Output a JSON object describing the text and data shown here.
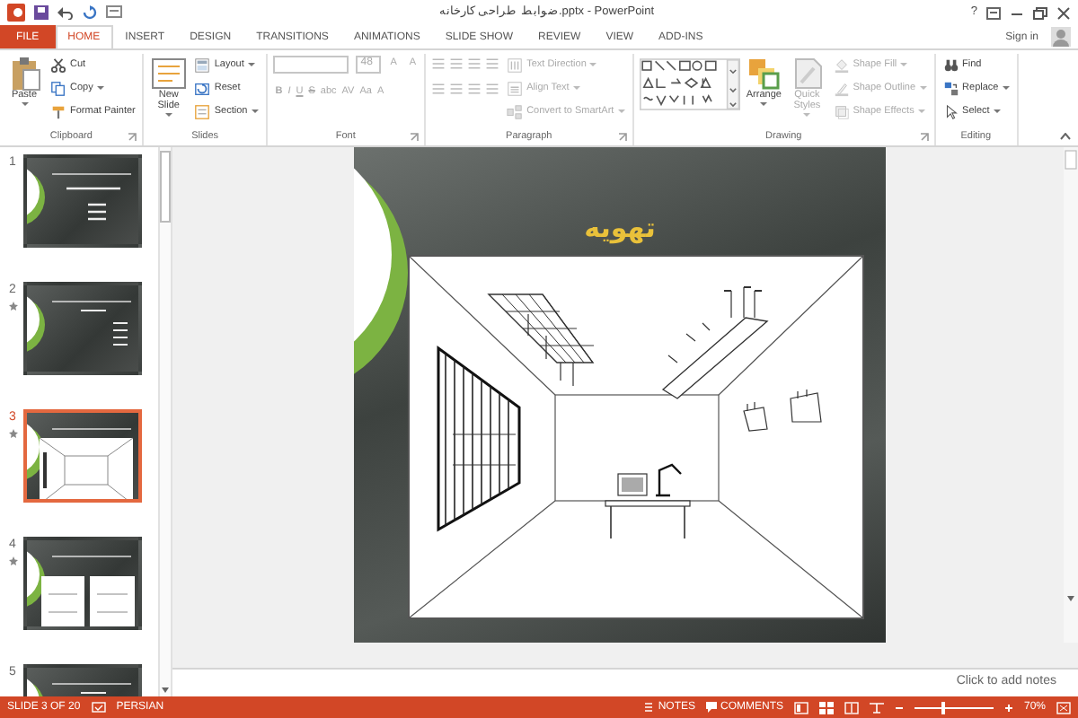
{
  "window": {
    "title": "ضوابط طراحی کارخانه.pptx - PowerPoint",
    "help": "?"
  },
  "tabs": [
    {
      "label": "FILE",
      "kind": "file",
      "selected": false
    },
    {
      "label": "HOME",
      "kind": "tab",
      "selected": true
    },
    {
      "label": "INSERT",
      "kind": "tab",
      "selected": false
    },
    {
      "label": "DESIGN",
      "kind": "tab",
      "selected": false
    },
    {
      "label": "TRANSITIONS",
      "kind": "tab",
      "selected": false
    },
    {
      "label": "ANIMATIONS",
      "kind": "tab",
      "selected": false
    },
    {
      "label": "SLIDE SHOW",
      "kind": "tab",
      "selected": false
    },
    {
      "label": "REVIEW",
      "kind": "tab",
      "selected": false
    },
    {
      "label": "VIEW",
      "kind": "tab",
      "selected": false
    },
    {
      "label": "ADD-INS",
      "kind": "tab",
      "selected": false
    }
  ],
  "account": {
    "label": "Sign in"
  },
  "ribbon": [
    {
      "label": "Clipboard",
      "kind": "standard",
      "launcher": true,
      "columns": [
        [
          {
            "label": "Paste",
            "kind": "large",
            "dropdown": true,
            "disabled": false
          }
        ],
        [
          {
            "label": "Cut",
            "kind": "small",
            "dropdown": false,
            "disabled": false
          },
          {
            "label": "Copy",
            "kind": "small",
            "dropdown": true,
            "disabled": false
          },
          {
            "label": "Format Painter",
            "kind": "small",
            "dropdown": false,
            "disabled": false
          }
        ]
      ]
    },
    {
      "label": "Slides",
      "kind": "standard",
      "launcher": false,
      "columns": [
        [
          {
            "label": "New Slide",
            "kind": "large",
            "dropdown": true,
            "disabled": false
          }
        ],
        [
          {
            "label": "Layout",
            "kind": "small",
            "dropdown": true,
            "disabled": false
          },
          {
            "label": "Reset",
            "kind": "small",
            "dropdown": false,
            "disabled": false
          },
          {
            "label": "Section",
            "kind": "small",
            "dropdown": true,
            "disabled": false
          }
        ]
      ]
    },
    {
      "label": "Font",
      "kind": "font",
      "launcher": true,
      "disabled": true,
      "font_size": "48",
      "row_1": [
        "A",
        "A"
      ],
      "row_2": [
        "B",
        "I",
        "U",
        "S",
        "abc",
        "AV",
        "Aa",
        "A"
      ]
    },
    {
      "label": "Paragraph",
      "kind": "paragraph",
      "launcher": true,
      "columns": [
        [
          {
            "label": "Text Direction",
            "kind": "small",
            "dropdown": true,
            "disabled": true
          },
          {
            "label": "Align Text",
            "kind": "small",
            "dropdown": true,
            "disabled": true
          },
          {
            "label": "Convert to SmartArt",
            "kind": "small",
            "dropdown": true,
            "disabled": true
          }
        ]
      ]
    },
    {
      "label": "Drawing",
      "kind": "standard",
      "launcher": true,
      "columns": [
        [
          {
            "kind": "gallery"
          }
        ],
        [
          {
            "label": "Arrange",
            "kind": "large",
            "dropdown": true,
            "disabled": false
          }
        ],
        [
          {
            "label": "Quick Styles",
            "kind": "large",
            "dropdown": true,
            "disabled": true
          }
        ],
        [
          {
            "label": "Shape Fill",
            "kind": "small",
            "dropdown": true,
            "disabled": true
          },
          {
            "label": "Shape Outline",
            "kind": "small",
            "dropdown": true,
            "disabled": true
          },
          {
            "label": "Shape Effects",
            "kind": "small",
            "dropdown": true,
            "disabled": true
          }
        ]
      ]
    },
    {
      "label": "Editing",
      "kind": "standard",
      "launcher": false,
      "columns": [
        [
          {
            "label": "Find",
            "kind": "small",
            "dropdown": false,
            "disabled": false
          },
          {
            "label": "Replace",
            "kind": "small",
            "dropdown": true,
            "disabled": false
          },
          {
            "label": "Select",
            "kind": "small",
            "dropdown": true,
            "disabled": false
          }
        ]
      ]
    }
  ],
  "thumbnails": [
    {
      "number": "1",
      "kind": "title",
      "animated": false,
      "selected": false
    },
    {
      "number": "2",
      "kind": "text",
      "animated": true,
      "selected": false
    },
    {
      "number": "3",
      "kind": "diagram",
      "animated": true,
      "selected": true
    },
    {
      "number": "4",
      "kind": "two_diagrams",
      "animated": true,
      "selected": false
    },
    {
      "number": "5",
      "kind": "text",
      "animated": false,
      "selected": false
    }
  ],
  "slide": {
    "title": "تهویه"
  },
  "notes": {
    "placeholder": "Click to add notes"
  },
  "status_bar": {
    "slide_info": "SLIDE 3 OF 20",
    "language": "PERSIAN",
    "notes": "NOTES",
    "comments": "COMMENTS",
    "zoom": {
      "level": 0.35,
      "reading": "70%"
    }
  }
}
